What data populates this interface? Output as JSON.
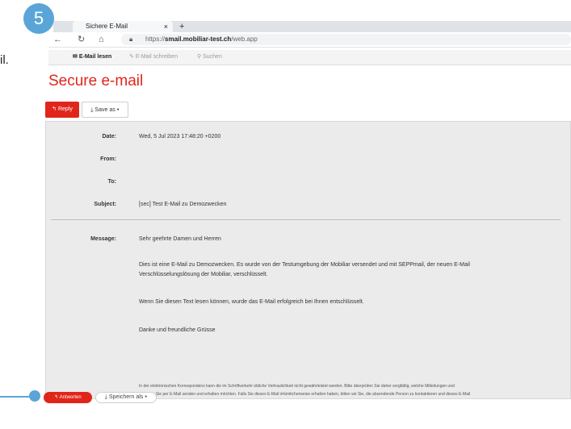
{
  "fragment": {
    "text": "il."
  },
  "step_badge": "5",
  "browser": {
    "tab_title": "Sichere E-Mail",
    "tab_close": "×",
    "new_tab": "+",
    "url_prefix": "https://",
    "url_host": "smail.mobiliar-test.ch",
    "url_path": "/web.app"
  },
  "appnav": {
    "read": "E-Mail lesen",
    "write": "E-Mail schreiben",
    "search": "Suchen"
  },
  "page_title": "Secure e-mail",
  "toolbar": {
    "reply": "Reply",
    "save_as": "Save as"
  },
  "headers": {
    "date_label": "Date:",
    "date_value": "Wed, 5 Jul 2023 17:48:20 +0200",
    "from_label": "From:",
    "to_label": "To:",
    "subject_label": "Subject:",
    "subject_value": "[sec] Test E-Mail zu Demozwecken"
  },
  "message": {
    "label": "Message:",
    "greeting": "Sehr geehrte Damen und Herren",
    "p1": "Dies ist eine E-Mail zu Demozwecken. Es wurde von der Testumgebung der Mobiliar versendet und mit SEPPmail, der neuen E-Mail Verschlüsselungslösung der Mobiliar, verschlüsselt.",
    "p2": "Wenn Sie diesen Text lesen können, wurde das E-Mail erfolgreich bei Ihnen entschlüsselt.",
    "p3": "Danke und freundliche Grüsse",
    "footer1": "In der elektronischen Korrespondenz kann die im Schriftverkehr übliche Vertraulichkeit nicht gewährleistet werden. Bitte überprüfen Sie daher sorgfältig, welche Mitteilungen und",
    "footer2": "Beilagen Sie per E-Mail senden und erhalten möchten. Falls Sie dieses E-Mail irrtümlicherweise erhalten haben, bitten wir Sie, die absendende Person zu kontaktieren und dieses E-Mail"
  },
  "bottom": {
    "reply": "Antworten",
    "save": "Speichern als"
  },
  "colors": {
    "accent": "#e0261a",
    "badge": "#5aa5d8"
  }
}
